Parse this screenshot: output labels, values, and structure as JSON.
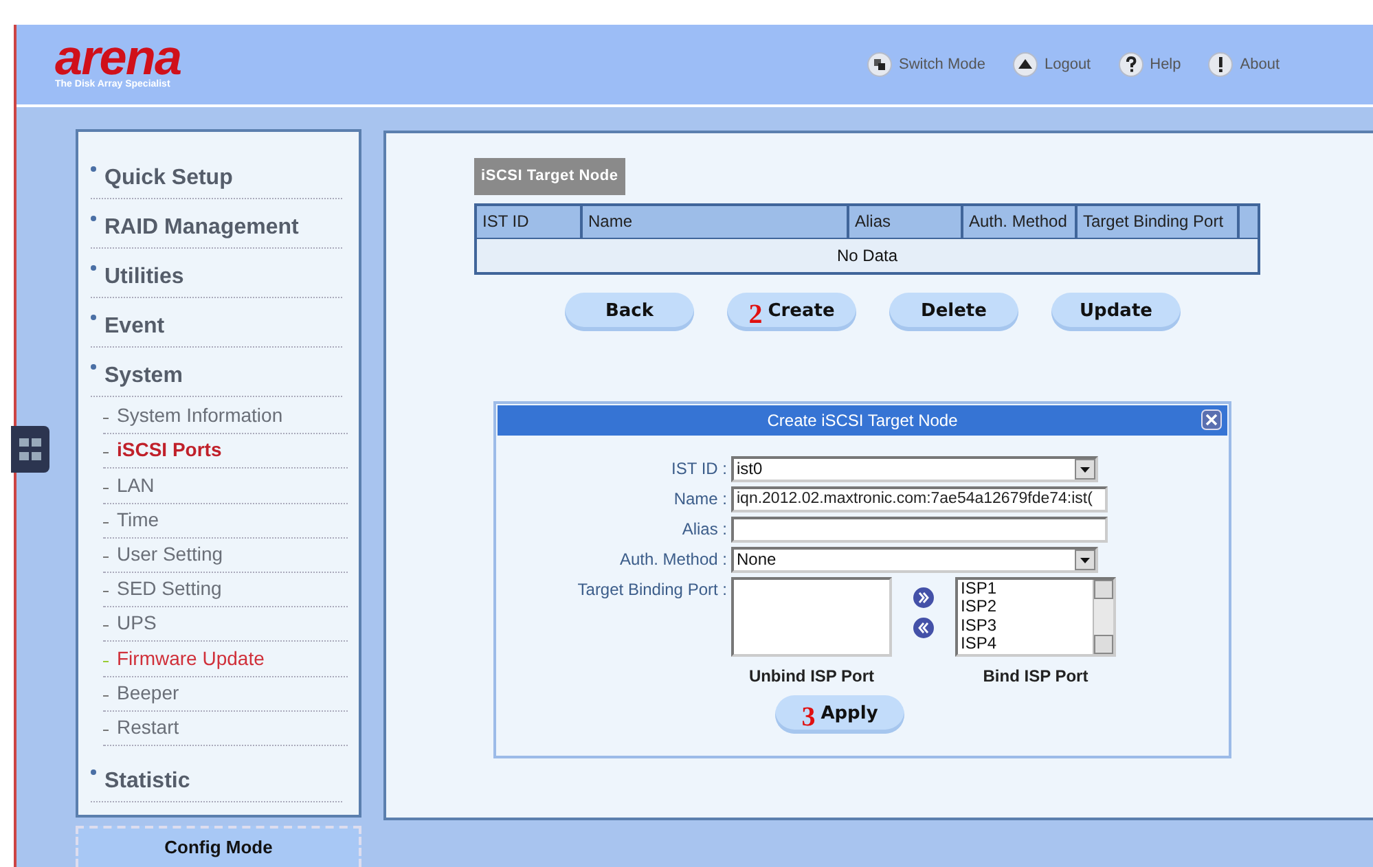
{
  "header": {
    "logo": "arena",
    "tagline": "The Disk Array Specialist",
    "links": [
      {
        "label": "Switch Mode",
        "kind": "switch"
      },
      {
        "label": "Logout",
        "kind": "logout"
      },
      {
        "label": "Help",
        "kind": "help"
      },
      {
        "label": "About",
        "kind": "about"
      }
    ]
  },
  "sidebar": {
    "items": [
      {
        "label": "Quick Setup"
      },
      {
        "label": "RAID Management"
      },
      {
        "label": "Utilities"
      },
      {
        "label": "Event"
      },
      {
        "label": "System",
        "children": [
          {
            "label": "System Information",
            "selected": false,
            "highlighted": false
          },
          {
            "label": "iSCSI Ports",
            "selected": true,
            "highlighted": false
          },
          {
            "label": "LAN",
            "selected": false,
            "highlighted": false
          },
          {
            "label": "Time",
            "selected": false,
            "highlighted": false
          },
          {
            "label": "User Setting",
            "selected": false,
            "highlighted": false
          },
          {
            "label": "SED Setting",
            "selected": false,
            "highlighted": false
          },
          {
            "label": "UPS",
            "selected": false,
            "highlighted": false
          },
          {
            "label": "Firmware Update",
            "selected": false,
            "highlighted": true
          },
          {
            "label": "Beeper",
            "selected": false,
            "highlighted": false
          },
          {
            "label": "Restart",
            "selected": false,
            "highlighted": false
          }
        ]
      },
      {
        "label": "Statistic"
      }
    ]
  },
  "mode_tab": "Config Mode",
  "panel": {
    "title": "iSCSI Target Node",
    "table": {
      "columns": [
        "IST ID",
        "Name",
        "Alias",
        "Auth. Method",
        "Target Binding Port"
      ],
      "empty": "No Data"
    },
    "buttons": [
      {
        "label": "Back"
      },
      {
        "label": "Create",
        "marker": "2"
      },
      {
        "label": "Delete"
      },
      {
        "label": "Update"
      }
    ]
  },
  "dialog": {
    "title": "Create iSCSI Target Node",
    "fields": [
      {
        "label": "IST ID :",
        "kind": "select",
        "value": "ist0"
      },
      {
        "label": "Name :",
        "kind": "text",
        "value": "iqn.2012.02.maxtronic.com:7ae54a12679fde74:ist("
      },
      {
        "label": "Alias :",
        "kind": "text"
      },
      {
        "label": "Auth. Method :",
        "kind": "select",
        "value": "None"
      }
    ],
    "binding": {
      "label": "Target Binding Port :",
      "unbind_caption": "Unbind ISP Port",
      "bind_caption": "Bind ISP Port",
      "bound": [
        "ISP1",
        "ISP2",
        "ISP3",
        "ISP4"
      ]
    },
    "apply": {
      "label": "Apply",
      "marker": "3"
    }
  }
}
